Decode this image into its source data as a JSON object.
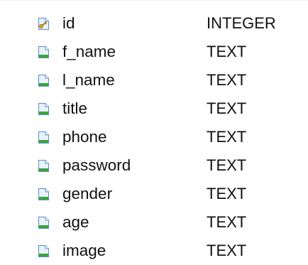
{
  "columns": [
    {
      "name": "id",
      "type": "INTEGER",
      "icon": "primary-key-column-icon"
    },
    {
      "name": "f_name",
      "type": "TEXT",
      "icon": "column-icon"
    },
    {
      "name": "l_name",
      "type": "TEXT",
      "icon": "column-icon"
    },
    {
      "name": "title",
      "type": "TEXT",
      "icon": "column-icon"
    },
    {
      "name": "phone",
      "type": "TEXT",
      "icon": "column-icon"
    },
    {
      "name": "password",
      "type": "TEXT",
      "icon": "column-icon"
    },
    {
      "name": "gender",
      "type": "TEXT",
      "icon": "column-icon"
    },
    {
      "name": "age",
      "type": "TEXT",
      "icon": "column-icon"
    },
    {
      "name": "image",
      "type": "TEXT",
      "icon": "column-icon"
    }
  ],
  "colors": {
    "icon_green": "#3aa53a",
    "icon_key": "#e0a020",
    "icon_border": "#5b8ec7",
    "icon_fill": "#e9f2fb"
  }
}
